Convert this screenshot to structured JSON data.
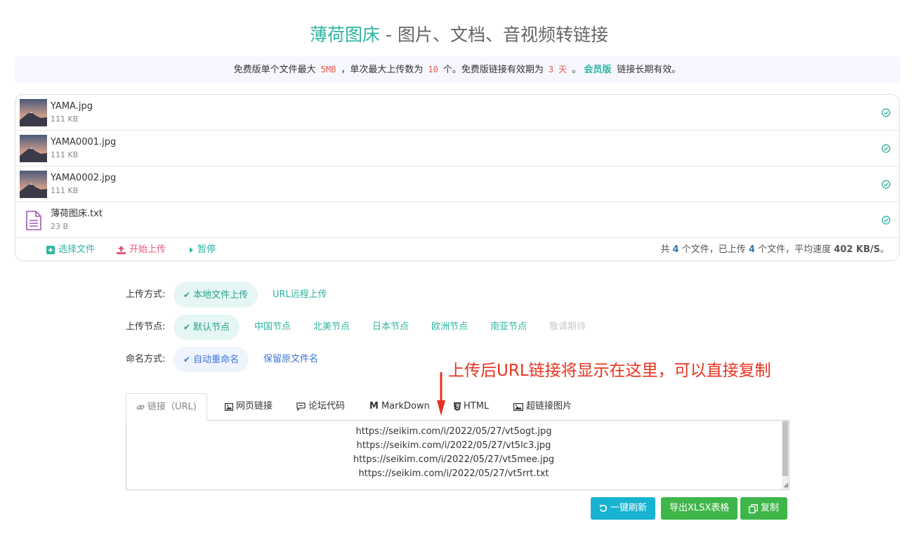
{
  "header": {
    "brand": "薄荷图床",
    "rest": " - 图片、文档、音视频转链接"
  },
  "notice": {
    "part1": "免费版单个文件最大",
    "size": "5MB",
    "part2": "，单次最大上传数为",
    "count": "10",
    "part3": "个。免费版链接有效期为",
    "days": "3 天",
    "part4": "。",
    "member": "会员版",
    "part5": "链接长期有效。"
  },
  "files": [
    {
      "name": "YAMA.jpg",
      "size": "111 KB",
      "type": "image"
    },
    {
      "name": "YAMA0001.jpg",
      "size": "111 KB",
      "type": "image"
    },
    {
      "name": "YAMA0002.jpg",
      "size": "111 KB",
      "type": "image"
    },
    {
      "name": "薄荷图床.txt",
      "size": "23 B",
      "type": "text"
    }
  ],
  "file_actions": {
    "select": "选择文件",
    "start": "开始上传",
    "pause": "暂停"
  },
  "stats": {
    "p1": "共",
    "total": "4",
    "p2": "个文件，已上传",
    "uploaded": "4",
    "p3": "个文件，平均速度",
    "speed": "402 KB/S",
    "p4": "。"
  },
  "options": {
    "method_label": "上传方式:",
    "methods": [
      "本地文件上传",
      "URL远程上传"
    ],
    "node_label": "上传节点:",
    "nodes": [
      "默认节点",
      "中国节点",
      "北美节点",
      "日本节点",
      "欧洲节点",
      "南亚节点",
      "敬请期待"
    ],
    "naming_label": "命名方式:",
    "namings": [
      "自动重命名",
      "保留原文件名"
    ]
  },
  "annotation": "上传后URL链接将显示在这里，可以直接复制",
  "tabs": [
    "链接（URL)",
    "网页链接",
    "论坛代码",
    "MarkDown",
    "HTML",
    "超链接图片"
  ],
  "links": [
    "https://seikim.com/i/2022/05/27/vt5ogt.jpg",
    "https://seikim.com/i/2022/05/27/vt5lc3.jpg",
    "https://seikim.com/i/2022/05/27/vt5mee.jpg",
    "https://seikim.com/i/2022/05/27/vt5rrt.txt"
  ],
  "buttons": {
    "refresh": "一键刷新",
    "xlsx": "导出XLSX表格",
    "copy": "复制"
  },
  "colors": {
    "brand": "#2cb5a0",
    "accent_red": "#e8584a",
    "refresh_btn": "#17b3d1",
    "green_btn": "#3fb649"
  }
}
